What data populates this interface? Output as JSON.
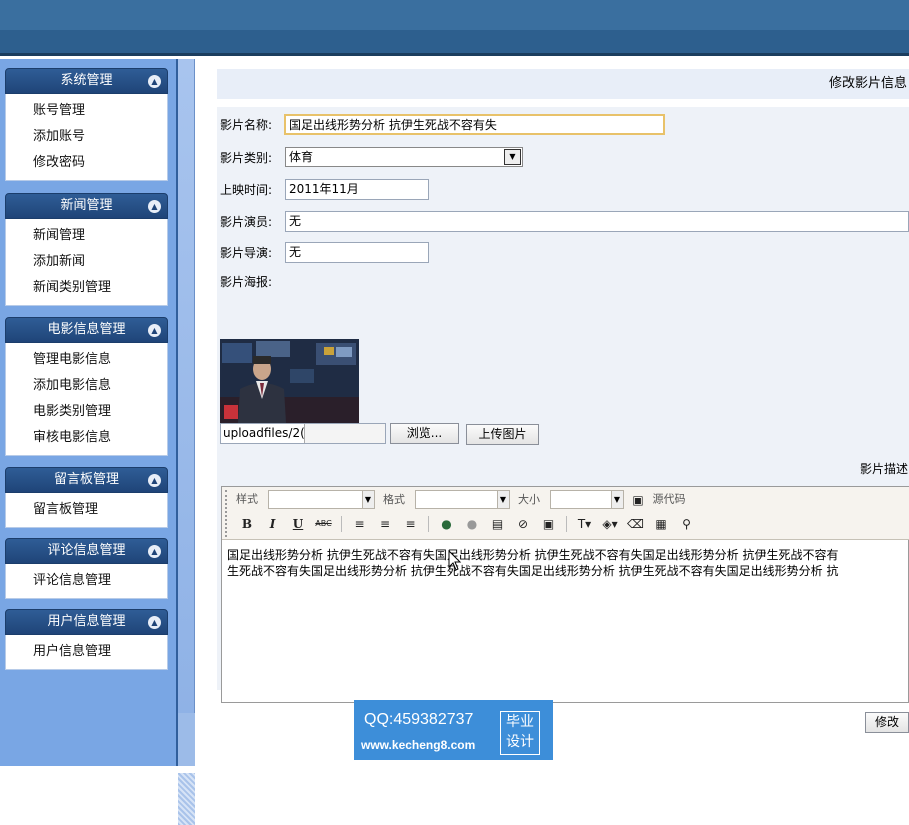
{
  "sidebar": {
    "groups": [
      {
        "title": "系统管理",
        "items": [
          "账号管理",
          "添加账号",
          "修改密码"
        ]
      },
      {
        "title": "新闻管理",
        "items": [
          "新闻管理",
          "添加新闻",
          "新闻类别管理"
        ]
      },
      {
        "title": "电影信息管理",
        "items": [
          "管理电影信息",
          "添加电影信息",
          "电影类别管理",
          "审核电影信息"
        ]
      },
      {
        "title": "留言板管理",
        "items": [
          "留言板管理"
        ]
      },
      {
        "title": "评论信息管理",
        "items": [
          "评论信息管理"
        ]
      },
      {
        "title": "用户信息管理",
        "items": [
          "用户信息管理"
        ]
      }
    ],
    "collapse_icon": "chevron-up-circle-icon"
  },
  "main": {
    "title": "修改影片信息"
  },
  "form": {
    "name_label": "影片名称:",
    "name_value": "国足出线形势分析 抗伊生死战不容有失",
    "category_label": "影片类别:",
    "category_value": "体育",
    "release_label": "上映时间:",
    "release_value": "2011年11月",
    "actors_label": "影片演员:",
    "actors_value": "无",
    "director_label": "影片导演:",
    "director_value": "无",
    "poster_label": "影片海报:",
    "poster_path": "uploadfiles/2(",
    "browse_label": "浏览...",
    "upload_label": "上传图片",
    "desc_label": "影片描述",
    "submit_label": "修改"
  },
  "editor": {
    "style_label": "样式",
    "format_label": "格式",
    "size_label": "大小",
    "source_label": "源代码",
    "bold": "B",
    "italic": "I",
    "underline": "U",
    "strike": "ABC",
    "content_line1": "国足出线形势分析 抗伊生死战不容有失国足出线形势分析 抗伊生死战不容有失国足出线形势分析 抗伊生死战不容有",
    "content_line2": "生死战不容有失国足出线形势分析 抗伊生死战不容有失国足出线形势分析 抗伊生死战不容有失国足出线形势分析 抗"
  },
  "watermark": {
    "qq": "QQ:459382737",
    "url": "www.kecheng8.com",
    "badge_line1": "毕业",
    "badge_line2": "设计"
  },
  "colors": {
    "sidebar_bg": "#79a6e4",
    "header_bg": "#2d5f8e",
    "group_header": "#1f4478",
    "watermark_bg": "#3d8ed9"
  }
}
